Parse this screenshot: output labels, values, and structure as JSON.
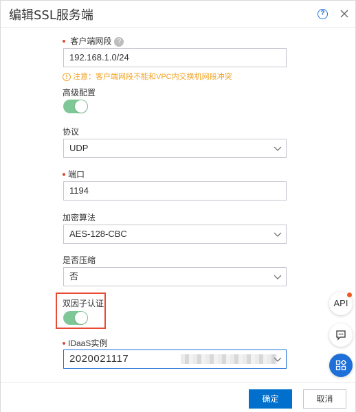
{
  "dialog": {
    "title": "编辑SSL服务端",
    "help_label": "?"
  },
  "form": {
    "client_subnet": {
      "label": "客户端网段",
      "hint": "?",
      "value": "192.168.1.0/24",
      "warning": "注意：客户端网段不能和VPC内交换机网段冲突"
    },
    "advanced": {
      "label": "高级配置",
      "enabled": true
    },
    "protocol": {
      "label": "协议",
      "value": "UDP"
    },
    "port": {
      "label": "端口",
      "value": "1194"
    },
    "cipher": {
      "label": "加密算法",
      "value": "AES-128-CBC"
    },
    "compress": {
      "label": "是否压缩",
      "value": "否"
    },
    "two_factor": {
      "label": "双因子认证",
      "enabled": true
    },
    "idaas": {
      "label": "IDaaS实例",
      "value": "2020021117"
    }
  },
  "footer": {
    "confirm_label": "确定",
    "cancel_label": "取消"
  },
  "floating": {
    "api_label": "API"
  },
  "colors": {
    "primary": "#0070cc",
    "switch_on": "#7fc797",
    "warning": "#f1a325",
    "required_dot": "#e0473b",
    "highlight": "#e84a33"
  }
}
